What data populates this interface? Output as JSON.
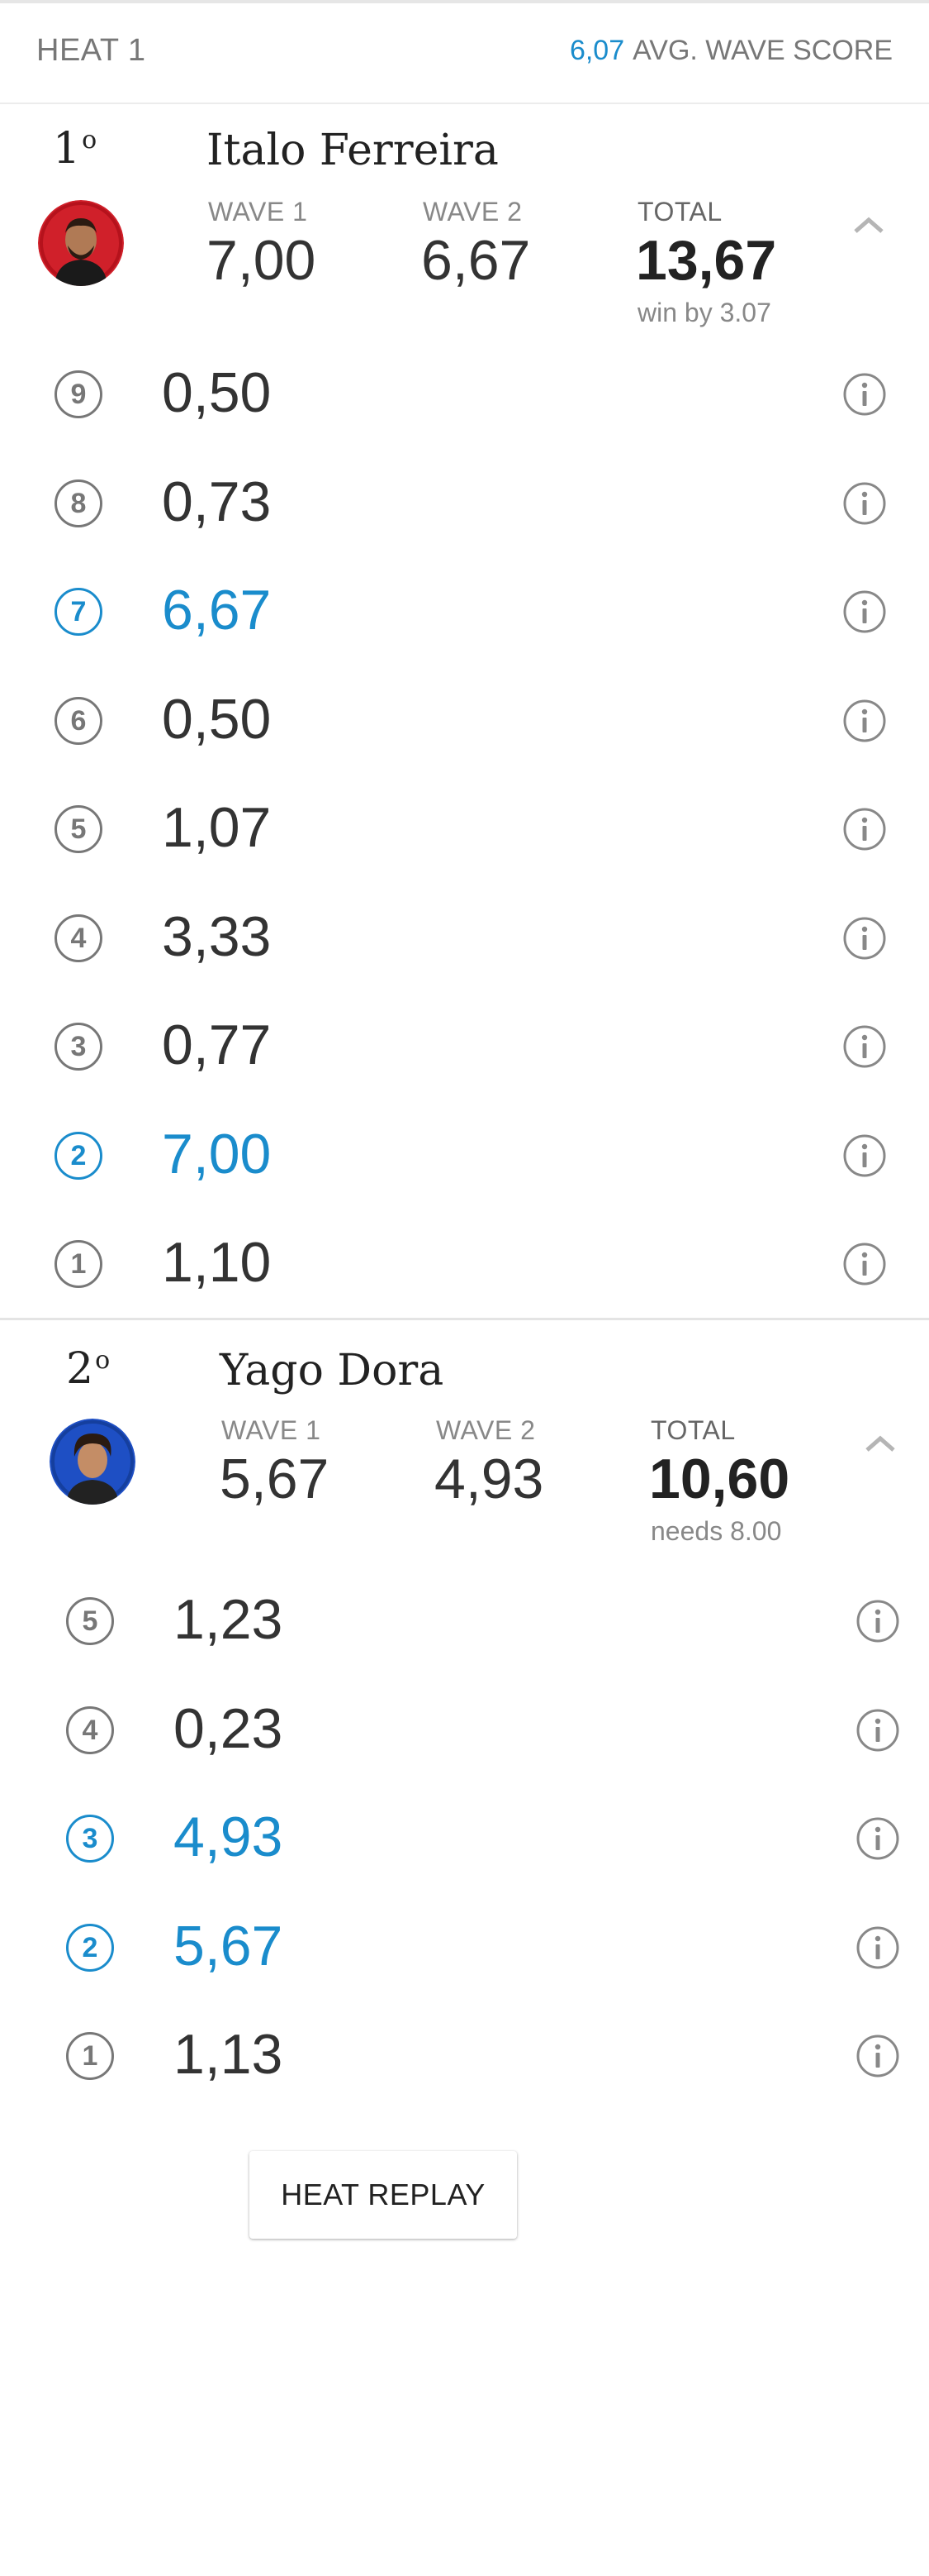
{
  "heat": {
    "title": "HEAT 1",
    "avg_score": "6,07",
    "avg_label": "AVG. WAVE SCORE"
  },
  "surfers": [
    {
      "place": "1",
      "place_suffix": "o",
      "name": "Italo Ferreira",
      "avatar_color": "#d0202a",
      "wave1_label": "WAVE 1",
      "wave1_value": "7,00",
      "wave2_label": "WAVE 2",
      "wave2_value": "6,67",
      "total_label": "TOTAL",
      "total_value": "13,67",
      "status": "win by 3.07",
      "waves": [
        {
          "num": "9",
          "score": "0,50",
          "best": false
        },
        {
          "num": "8",
          "score": "0,73",
          "best": false
        },
        {
          "num": "7",
          "score": "6,67",
          "best": true
        },
        {
          "num": "6",
          "score": "0,50",
          "best": false
        },
        {
          "num": "5",
          "score": "1,07",
          "best": false
        },
        {
          "num": "4",
          "score": "3,33",
          "best": false
        },
        {
          "num": "3",
          "score": "0,77",
          "best": false
        },
        {
          "num": "2",
          "score": "7,00",
          "best": true
        },
        {
          "num": "1",
          "score": "1,10",
          "best": false
        }
      ]
    },
    {
      "place": "2",
      "place_suffix": "o",
      "name": "Yago Dora",
      "avatar_color": "#1e4fc4",
      "wave1_label": "WAVE 1",
      "wave1_value": "5,67",
      "wave2_label": "WAVE 2",
      "wave2_value": "4,93",
      "total_label": "TOTAL",
      "total_value": "10,60",
      "status": "needs 8.00",
      "waves": [
        {
          "num": "5",
          "score": "1,23",
          "best": false
        },
        {
          "num": "4",
          "score": "0,23",
          "best": false
        },
        {
          "num": "3",
          "score": "4,93",
          "best": true
        },
        {
          "num": "2",
          "score": "5,67",
          "best": true
        },
        {
          "num": "1",
          "score": "1,13",
          "best": false
        }
      ]
    }
  ],
  "replay_label": "HEAT REPLAY",
  "colors": {
    "accent": "#1a8ccc",
    "text": "#222222",
    "muted": "#888888"
  },
  "icons": [
    "info-icon",
    "chevron-up-icon",
    "avatar"
  ]
}
